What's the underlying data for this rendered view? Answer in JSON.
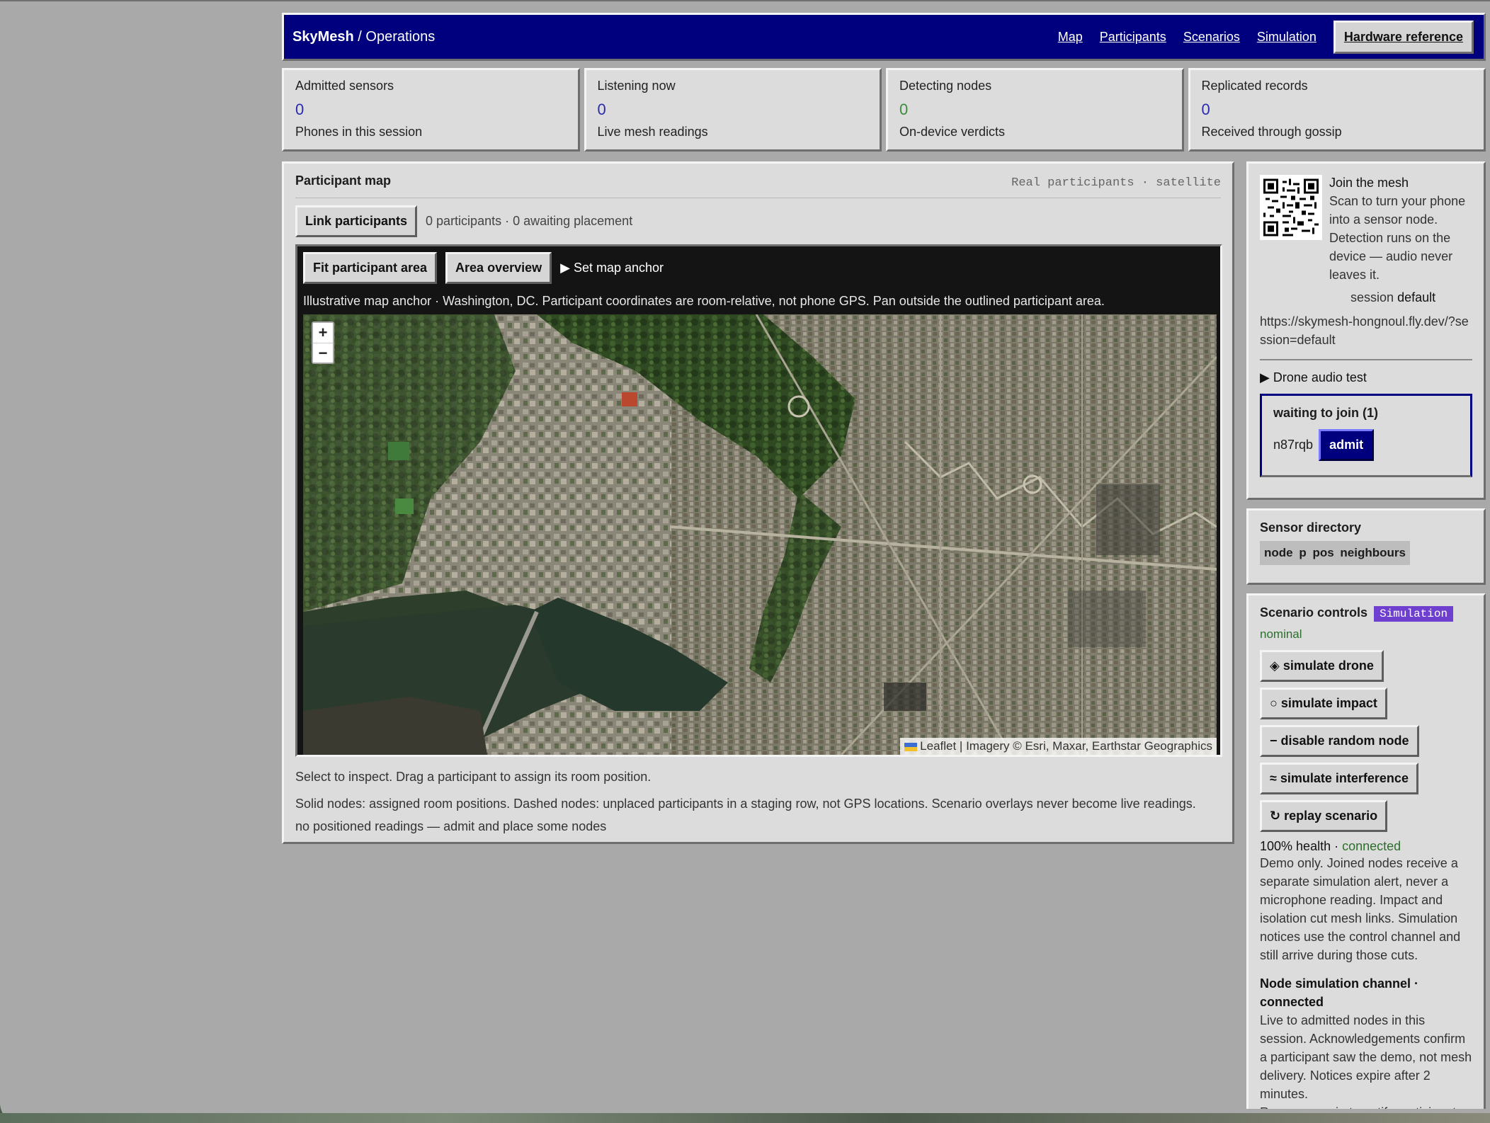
{
  "header": {
    "brand": "SkyMesh",
    "sep": " / ",
    "section": "Operations",
    "nav": [
      "Map",
      "Participants",
      "Scenarios",
      "Simulation"
    ],
    "active": "Hardware reference"
  },
  "stats": [
    {
      "label": "Admitted sensors",
      "value": "0",
      "sub": "Phones in this session"
    },
    {
      "label": "Listening now",
      "value": "0",
      "sub": "Live mesh readings"
    },
    {
      "label": "Detecting nodes",
      "value": "0",
      "sub": "On-device verdicts"
    },
    {
      "label": "Replicated records",
      "value": "0",
      "sub": "Received through gossip"
    }
  ],
  "map": {
    "title": "Participant map",
    "tag": "Real participants · satellite",
    "link_btn": "Link participants",
    "counts": "0 participants · 0 awaiting placement",
    "fit_btn": "Fit participant area",
    "overview_btn": "Area overview",
    "anchor": "Set map anchor",
    "note": "Illustrative map anchor · Washington, DC. Participant coordinates are room-relative, not phone GPS. Pan outside the outlined participant area.",
    "zoom_in": "+",
    "zoom_out": "−",
    "attribution_leaflet": "Leaflet",
    "attribution_rest": " | Imagery © Esri, Maxar, Earthstar Geographics",
    "foot1": "Select to inspect. Drag a participant to assign its room position.",
    "foot2": "Solid nodes: assigned room positions. Dashed nodes: unplaced participants in a staging row, not GPS locations. Scenario overlays never become live readings.",
    "foot3": "no positioned readings — admit and place some nodes"
  },
  "join": {
    "title": "Join the mesh",
    "desc": "Scan to turn your phone into a sensor node. Detection runs on the device — audio never leaves it.",
    "session_label": "session ",
    "session_value": "default",
    "url": "https://skymesh-hongnoul.fly.dev/?session=default",
    "drone_test": "Drone audio test",
    "waiting_title": "waiting to join (1)",
    "waiting_id": "n87rqb",
    "admit": "admit"
  },
  "directory": {
    "title": "Sensor directory",
    "chip": "node p pos neighbours"
  },
  "scenario": {
    "title": "Scenario controls",
    "badge": "Simulation",
    "status": "nominal",
    "buttons": [
      "◈ simulate drone",
      "○ simulate impact",
      "− disable random node",
      "≈ simulate interference",
      "↻ replay scenario"
    ],
    "health_pct": "100%",
    "health_label": " health · ",
    "health_state": "connected",
    "demo_note": "Demo only. Joined nodes receive a separate simulation alert, never a microphone reading. Impact and isolation cut mesh links. Simulation notices use the control channel and still arrive during those cuts.",
    "channel_title": "Node simulation channel · connected",
    "channel_desc": "Live to admitted nodes in this session. Acknowledgements confirm a participant saw the demo, not mesh delivery. Notices expire after 2 minutes.",
    "run_note": "Run a scenario to notify participants."
  },
  "colors": {
    "accent": "#00007f",
    "badge": "#6f3fcf",
    "ok": "#2d6e2d"
  }
}
